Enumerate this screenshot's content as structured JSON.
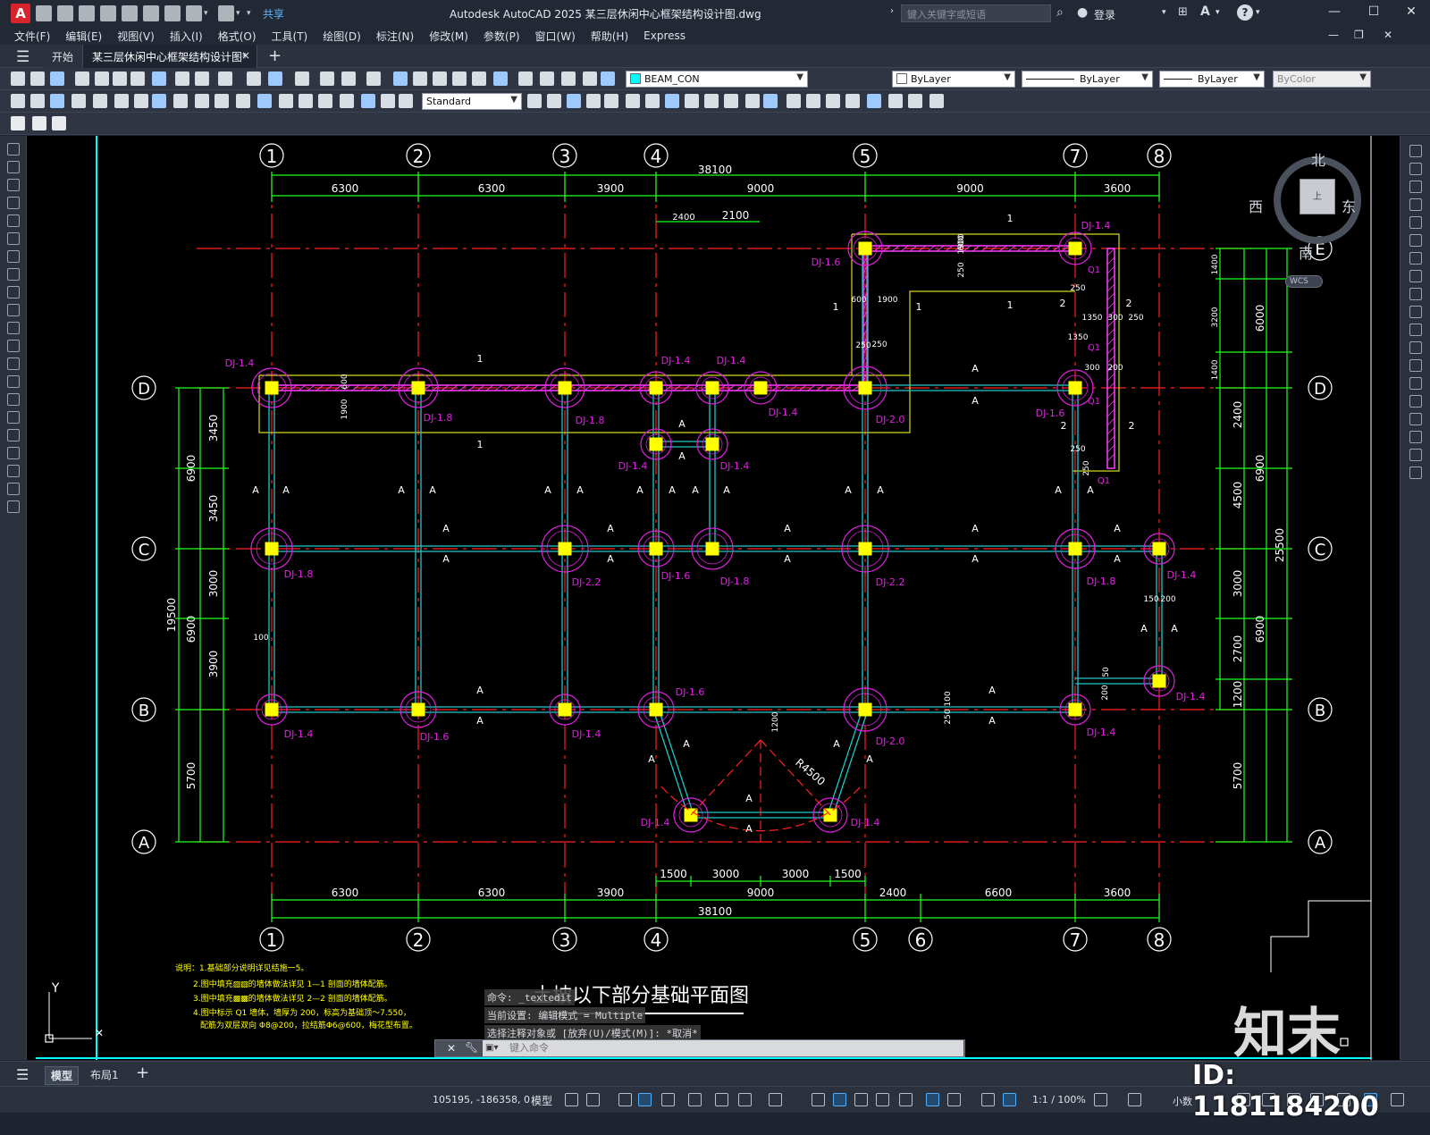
{
  "titlebar": {
    "logo": "A",
    "share_label": "共享",
    "app_title": "Autodesk AutoCAD 2025    某三层休闲中心框架结构设计图.dwg",
    "search_placeholder": "键入关键字或短语",
    "login_label": "登录",
    "help_label": "?",
    "icons": [
      "new-icon",
      "open-icon",
      "save-icon",
      "saveas-icon",
      "plot-icon",
      "undo-icon",
      "redo-icon",
      "share-icon",
      "search-icon",
      "user-icon",
      "cart-icon",
      "a360-icon",
      "help-icon"
    ]
  },
  "menubar": {
    "items": [
      "文件(F)",
      "编辑(E)",
      "视图(V)",
      "插入(I)",
      "格式(O)",
      "工具(T)",
      "绘图(D)",
      "标注(N)",
      "修改(M)",
      "参数(P)",
      "窗口(W)",
      "帮助(H)",
      "Express"
    ]
  },
  "tabs": {
    "start_label": "开始",
    "drawing_label": "某三层休闲中心框架结构设计图*",
    "close_glyph": "×",
    "add_glyph": "+"
  },
  "toolbar": {
    "layer_value": "BEAM_CON",
    "color_value": "ByLayer",
    "linetype_value": "ByLayer",
    "lineweight_value": "ByLayer",
    "plotstyle_value": "ByColor",
    "textstyle_value": "Standard",
    "layer_color": "#00ffff"
  },
  "viewcube": {
    "north": "北",
    "south": "南",
    "east": "东",
    "west": "西",
    "face_label": "上",
    "wcs_label": "WCS"
  },
  "drawing": {
    "colors": {
      "grid_line": "#ff2020",
      "dimension": "#20ff20",
      "beam": "#20c8c8",
      "footing": "#e020e0",
      "column": "#ffff00",
      "wall": "#ff3cff",
      "note": "#ffff00",
      "text_white": "#ffffff",
      "frame": "#00ffff"
    },
    "col_axes": [
      "1",
      "2",
      "3",
      "4",
      "5",
      "7",
      "8"
    ],
    "bottom_col_axes": [
      "1",
      "2",
      "3",
      "4",
      "5",
      "6",
      "7",
      "8"
    ],
    "row_axes": [
      "D",
      "C",
      "B",
      "A"
    ],
    "right_row_axes": [
      "E",
      "D",
      "C",
      "B",
      "A"
    ],
    "top_dims": [
      "6300",
      "6300",
      "3900",
      "9000",
      "9000",
      "3600"
    ],
    "top_total": "38100",
    "bottom_dims": [
      "6300",
      "6300",
      "3900",
      "9000",
      "2400",
      "6600",
      "3600"
    ],
    "bottom_total": "38100",
    "bottom_sub_dims": [
      "1500",
      "3000",
      "3000",
      "1500"
    ],
    "left_dims": [
      "3450",
      "3450",
      "3000",
      "3900",
      "5700"
    ],
    "left_mid_dims": [
      "6900",
      "6900"
    ],
    "left_total": "19500",
    "right_dims": [
      "1400",
      "3200",
      "1400",
      "2400",
      "4500",
      "3000",
      "2700",
      "1200",
      "5700"
    ],
    "right_mid_dims": [
      "6000",
      "6900",
      "6900"
    ],
    "right_total": "25500",
    "top_small_dims": [
      "2400",
      "2100"
    ],
    "footing_labels": [
      {
        "t": "DJ-1.4",
        "c": "D1"
      },
      {
        "t": "DJ-1.8",
        "c": "D2"
      },
      {
        "t": "DJ-1.8",
        "c": "D3"
      },
      {
        "t": "DJ-1.4",
        "c": "D4a"
      },
      {
        "t": "DJ-1.4",
        "c": "D4b"
      },
      {
        "t": "DJ-1.4",
        "c": "D4c"
      },
      {
        "t": "DJ-2.0",
        "c": "D5"
      },
      {
        "t": "DJ-1.6",
        "c": "D7"
      },
      {
        "t": "DJ-1.6",
        "c": "E5"
      },
      {
        "t": "DJ-1.4",
        "c": "E7"
      },
      {
        "t": "DJ-1.4",
        "c": "m1"
      },
      {
        "t": "DJ-1.4",
        "c": "m2"
      },
      {
        "t": "DJ-1.8",
        "c": "C1"
      },
      {
        "t": "DJ-2.2",
        "c": "C3"
      },
      {
        "t": "DJ-1.6",
        "c": "C4"
      },
      {
        "t": "DJ-1.8",
        "c": "C4b"
      },
      {
        "t": "DJ-2.2",
        "c": "C5"
      },
      {
        "t": "DJ-1.8",
        "c": "C7"
      },
      {
        "t": "DJ-1.4",
        "c": "C8"
      },
      {
        "t": "DJ-1.4",
        "c": "B1"
      },
      {
        "t": "DJ-1.6",
        "c": "B2"
      },
      {
        "t": "DJ-1.4",
        "c": "B3"
      },
      {
        "t": "DJ-1.6",
        "c": "B4"
      },
      {
        "t": "DJ-2.0",
        "c": "B5"
      },
      {
        "t": "DJ-1.4",
        "c": "B7"
      },
      {
        "t": "DJ-1.4",
        "c": "B8"
      },
      {
        "t": "DJ-1.4",
        "c": "X1"
      },
      {
        "t": "DJ-1.4",
        "c": "X2"
      }
    ],
    "radius_label": "R4500",
    "small_dims": [
      "1900",
      "600",
      "250",
      "1900",
      "600",
      "1900",
      "250",
      "250",
      "1350",
      "300",
      "250",
      "1350",
      "300",
      "200",
      "250",
      "250",
      "100",
      "150",
      "200",
      "50",
      "200",
      "250",
      "100",
      "1200",
      "250",
      "600"
    ],
    "section_marks": [
      "A",
      "1",
      "2",
      "Q1"
    ],
    "drawing_title": "土坡以下部分基础平面图",
    "notes": [
      "说明：1.基础部分说明详见结施一5。",
      "2.图中填充▨▨的墙体做法详见 1—1 剖面的墙体配筋。",
      "3.图中填充▩▩的墙体做法详见 2—2 剖面的墙体配筋。",
      "4.图中标示 Q1 墙体，墙厚为 200，标高为基础顶～7.550，",
      "配筋为双层双向 Φ8@200，拉结筋Φ6@600，梅花型布置。"
    ],
    "ucs_y": "Y"
  },
  "command": {
    "history": [
      "命令: _textedit",
      "当前设置: 编辑模式 = Multiple",
      "选择注释对象或 [放弃(U)/模式(M)]: *取消*"
    ],
    "input_placeholder": "键入命令"
  },
  "layout_tabs": {
    "model": "模型",
    "layout1": "布局1",
    "add": "+"
  },
  "status": {
    "coords": "105195, -186358, 0",
    "model": "模型",
    "scale": "1:1 / 100%",
    "units": "小数"
  },
  "watermark": {
    "id_text": "ID: 1181184200",
    "brand": "知末"
  }
}
